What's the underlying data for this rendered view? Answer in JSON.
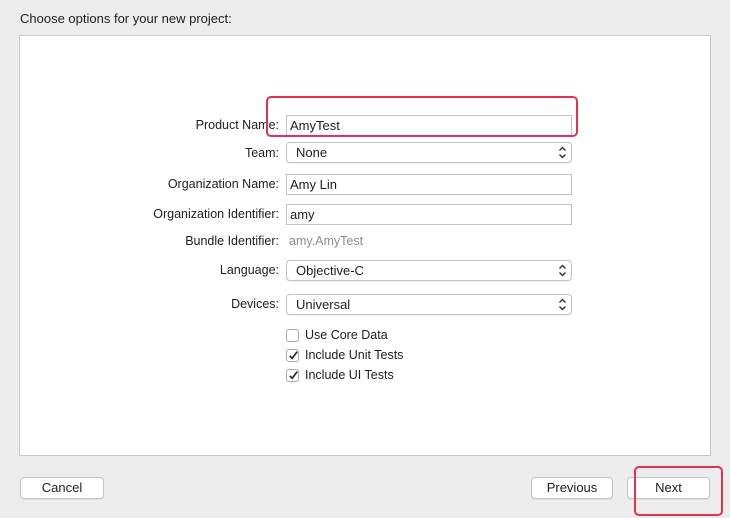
{
  "header": {
    "title": "Choose options for your new project:"
  },
  "form": {
    "product_name": {
      "label": "Product Name:",
      "value": "AmyTest"
    },
    "team": {
      "label": "Team:",
      "value": "None"
    },
    "organization_name": {
      "label": "Organization Name:",
      "value": "Amy Lin"
    },
    "organization_identifier": {
      "label": "Organization Identifier:",
      "value": "amy"
    },
    "bundle_identifier": {
      "label": "Bundle Identifier:",
      "value": "amy.AmyTest"
    },
    "language": {
      "label": "Language:",
      "value": "Objective-C"
    },
    "devices": {
      "label": "Devices:",
      "value": "Universal"
    },
    "checkboxes": [
      {
        "label": "Use Core Data",
        "checked": false
      },
      {
        "label": "Include Unit Tests",
        "checked": true
      },
      {
        "label": "Include UI Tests",
        "checked": true
      }
    ]
  },
  "footer": {
    "cancel_label": "Cancel",
    "previous_label": "Previous",
    "next_label": "Next"
  },
  "colors": {
    "highlight": "#e5304f"
  }
}
